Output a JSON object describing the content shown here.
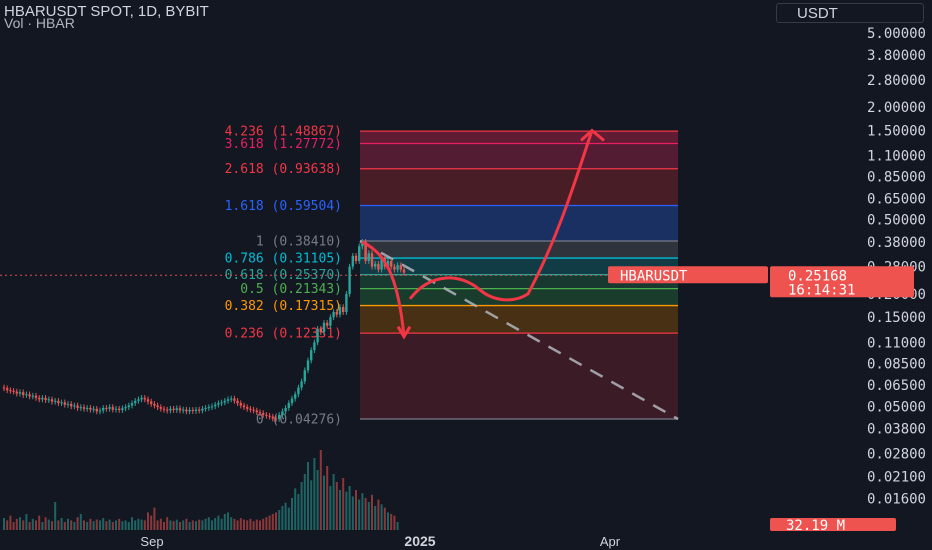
{
  "header": {
    "title": "HBARUSDT SPOT, 1D, BYBIT",
    "subtitle": "Vol · HBAR"
  },
  "currency_button": "USDT",
  "colors": {
    "background": "#131722",
    "up": "#26a69a",
    "down": "#ef5350",
    "drawing": "#f23645",
    "fib_bg": "#5b1f2a"
  },
  "chart_data": {
    "type": "candlestick",
    "y_scale": "log",
    "ylim": [
      0.0085,
      7.5
    ],
    "y_ticks": [
      "5.00000",
      "3.80000",
      "2.80000",
      "2.00000",
      "1.50000",
      "1.10000",
      "0.85000",
      "0.65000",
      "0.50000",
      "0.38000",
      "0.28000",
      "0.20000",
      "0.15000",
      "0.11000",
      "0.08500",
      "0.06500",
      "0.05000",
      "0.03800",
      "0.02800",
      "0.02100",
      "0.01600"
    ],
    "x_ticks": [
      "Sep",
      "2025",
      "Apr"
    ],
    "fib_levels": [
      {
        "label": "4.236 (1.48867)",
        "value": 1.48867,
        "color": "#f23645"
      },
      {
        "label": "3.618 (1.27772)",
        "value": 1.27772,
        "color": "#e91e63"
      },
      {
        "label": "2.618 (0.93638)",
        "value": 0.93638,
        "color": "#f23645"
      },
      {
        "label": "1.618 (0.59504)",
        "value": 0.59504,
        "color": "#2962ff"
      },
      {
        "label": "1 (0.38410)",
        "value": 0.3841,
        "color": "#787b86"
      },
      {
        "label": "0.786 (0.31105)",
        "value": 0.31105,
        "color": "#00bcd4"
      },
      {
        "label": "0.618 (0.25370)",
        "value": 0.2537,
        "color": "#26a69a"
      },
      {
        "label": "0.5 (0.21343)",
        "value": 0.21343,
        "color": "#4caf50"
      },
      {
        "label": "0.382 (0.17315)",
        "value": 0.17315,
        "color": "#ff9800"
      },
      {
        "label": "0.236 (0.12331)",
        "value": 0.12331,
        "color": "#f23645"
      },
      {
        "label": "0 (0.04276)",
        "value": 0.04276,
        "color": "#787b86"
      }
    ],
    "symbol_tag": "HBARUSDT",
    "last_price": "0.25168",
    "countdown": "16:14:31",
    "volume_label": "32.19 M",
    "price_series": [
      0.0625,
      0.061,
      0.0605,
      0.06,
      0.0585,
      0.0595,
      0.0575,
      0.058,
      0.0565,
      0.057,
      0.0555,
      0.0545,
      0.0555,
      0.054,
      0.0545,
      0.053,
      0.0535,
      0.052,
      0.0525,
      0.051,
      0.0515,
      0.05,
      0.0505,
      0.049,
      0.0495,
      0.0485,
      0.049,
      0.048,
      0.0485,
      0.047,
      0.0475,
      0.049,
      0.0485,
      0.0495,
      0.048,
      0.0485,
      0.0478,
      0.0488,
      0.0495,
      0.0505,
      0.052,
      0.0535,
      0.0545,
      0.0555,
      0.0545,
      0.053,
      0.0515,
      0.0505,
      0.0495,
      0.0485,
      0.048,
      0.0475,
      0.0485,
      0.0478,
      0.0488,
      0.0475,
      0.048,
      0.047,
      0.0478,
      0.0472,
      0.048,
      0.0475,
      0.0485,
      0.049,
      0.0495,
      0.05,
      0.051,
      0.052,
      0.0525,
      0.0535,
      0.0545,
      0.055,
      0.0535,
      0.052,
      0.0505,
      0.0495,
      0.0485,
      0.048,
      0.0475,
      0.0465,
      0.046,
      0.045,
      0.0445,
      0.044,
      0.043,
      0.0428,
      0.045,
      0.047,
      0.049,
      0.052,
      0.055,
      0.058,
      0.063,
      0.068,
      0.078,
      0.088,
      0.1,
      0.11,
      0.13,
      0.125,
      0.14,
      0.135,
      0.15,
      0.16,
      0.155,
      0.17,
      0.16,
      0.2,
      0.28,
      0.32,
      0.3,
      0.36,
      0.38,
      0.3,
      0.33,
      0.28,
      0.29,
      0.27,
      0.31,
      0.28,
      0.3,
      0.28,
      0.27,
      0.285,
      0.27,
      0.26
    ],
    "volume_series": [
      0.15,
      0.12,
      0.18,
      0.1,
      0.14,
      0.16,
      0.12,
      0.2,
      0.1,
      0.14,
      0.12,
      0.18,
      0.1,
      0.16,
      0.13,
      0.11,
      0.35,
      0.12,
      0.15,
      0.1,
      0.14,
      0.12,
      0.1,
      0.16,
      0.2,
      0.12,
      0.1,
      0.14,
      0.11,
      0.13,
      0.12,
      0.15,
      0.11,
      0.13,
      0.1,
      0.12,
      0.14,
      0.11,
      0.12,
      0.1,
      0.16,
      0.12,
      0.14,
      0.13,
      0.12,
      0.22,
      0.18,
      0.28,
      0.12,
      0.14,
      0.1,
      0.16,
      0.12,
      0.11,
      0.13,
      0.1,
      0.12,
      0.14,
      0.1,
      0.12,
      0.11,
      0.13,
      0.12,
      0.14,
      0.16,
      0.12,
      0.15,
      0.18,
      0.14,
      0.2,
      0.22,
      0.16,
      0.14,
      0.12,
      0.15,
      0.13,
      0.12,
      0.14,
      0.11,
      0.13,
      0.12,
      0.14,
      0.16,
      0.18,
      0.2,
      0.22,
      0.25,
      0.3,
      0.34,
      0.28,
      0.4,
      0.52,
      0.45,
      0.6,
      0.7,
      0.85,
      0.62,
      0.9,
      0.75,
      1.0,
      0.68,
      0.8,
      0.55,
      0.7,
      0.6,
      0.5,
      0.65,
      0.48,
      0.55,
      0.42,
      0.5,
      0.38,
      0.46,
      0.4,
      0.35,
      0.44,
      0.3,
      0.38,
      0.32,
      0.28,
      0.22,
      0.2,
      0.18,
      0.1
    ]
  }
}
